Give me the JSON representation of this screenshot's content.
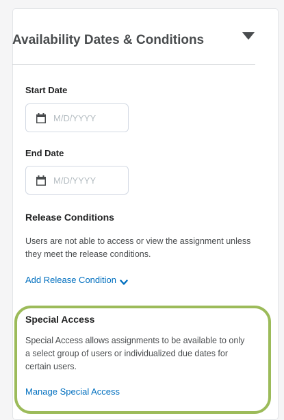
{
  "panel": {
    "title": "Availability Dates & Conditions",
    "toggle_icon": "caret-down-icon"
  },
  "start_date": {
    "label": "Start Date",
    "placeholder": "M/D/YYYY",
    "value": "",
    "icon": "calendar-icon"
  },
  "end_date": {
    "label": "End Date",
    "placeholder": "M/D/YYYY",
    "value": "",
    "icon": "calendar-icon"
  },
  "release_conditions": {
    "heading": "Release Conditions",
    "description": "Users are not able to access or view the assignment unless they meet the release conditions.",
    "add_link": "Add Release Condition",
    "add_link_icon": "chevron-down-icon"
  },
  "special_access": {
    "heading": "Special Access",
    "description": "Special Access allows assignments to be available to only a select group of users or individualized due dates for certain users.",
    "manage_link": "Manage Special Access",
    "highlight_color": "#9cbb5a"
  },
  "colors": {
    "link": "#006fbf",
    "heading": "#494c4e",
    "placeholder": "#b5bdc2"
  }
}
